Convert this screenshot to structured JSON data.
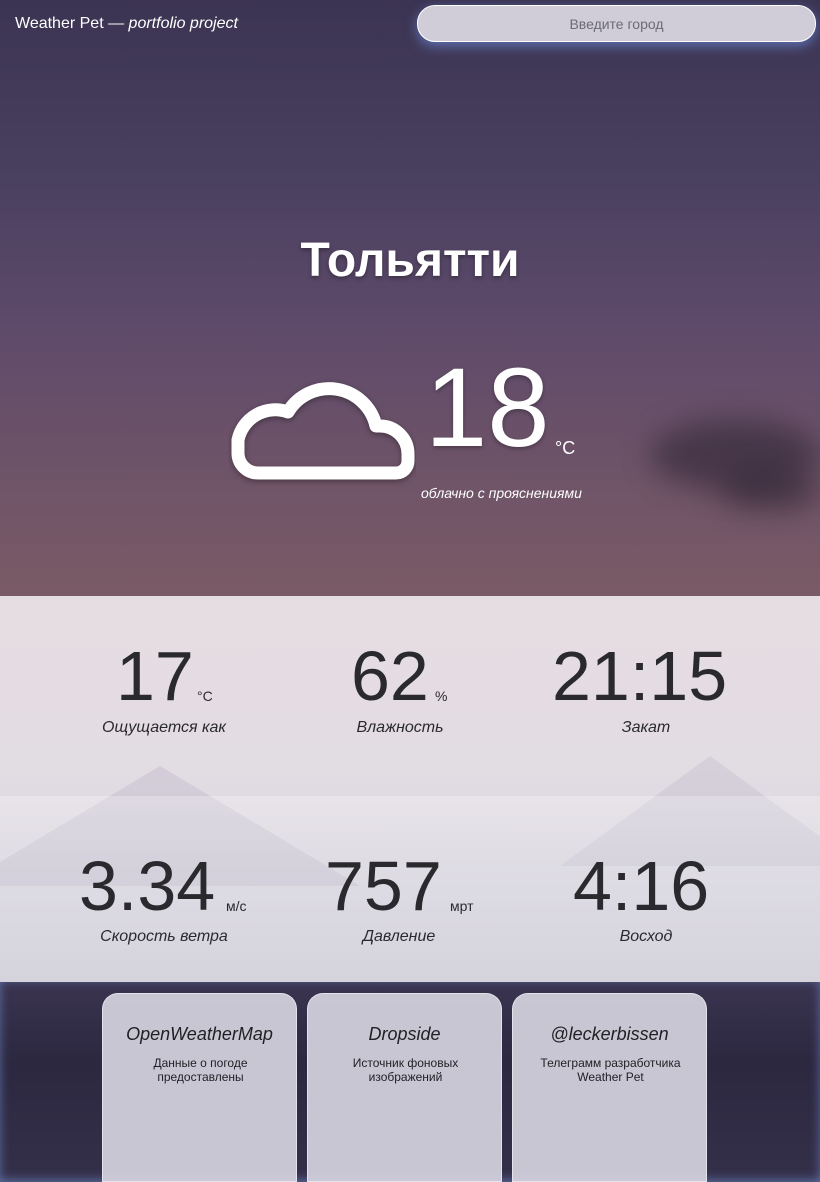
{
  "header": {
    "brand_name": "Weather Pet",
    "brand_separator": "—",
    "brand_tagline": "portfolio project",
    "search_placeholder": "Введите город"
  },
  "current": {
    "city": "Тольятти",
    "temperature": "18",
    "temperature_unit": "°C",
    "description": "облачно с прояснениями",
    "icon": "cloud-icon"
  },
  "stats": [
    {
      "value": "17",
      "unit": "°C",
      "label": "Ощущается как"
    },
    {
      "value": "62",
      "unit": "%",
      "label": "Влажность"
    },
    {
      "value": "21:15",
      "unit": "",
      "label": "Закат"
    },
    {
      "value": "3.34",
      "unit": "м/с",
      "label": "Скорость ветра"
    },
    {
      "value": "757",
      "unit": "мрт",
      "label": "Давление"
    },
    {
      "value": "4:16",
      "unit": "",
      "label": "Восход"
    }
  ],
  "cards": [
    {
      "title": "OpenWeatherMap",
      "text": "Данные о погоде предоставлены"
    },
    {
      "title": "Dropside",
      "text": "Источник фоновых изображений"
    },
    {
      "title": "@leckerbissen",
      "text": "Телеграмм разработчика Weather Pet"
    }
  ],
  "colors": {
    "accent_glow": "#78a0ff",
    "stat_text": "#2a2a2e",
    "card_bg": "#d6d4e0"
  }
}
